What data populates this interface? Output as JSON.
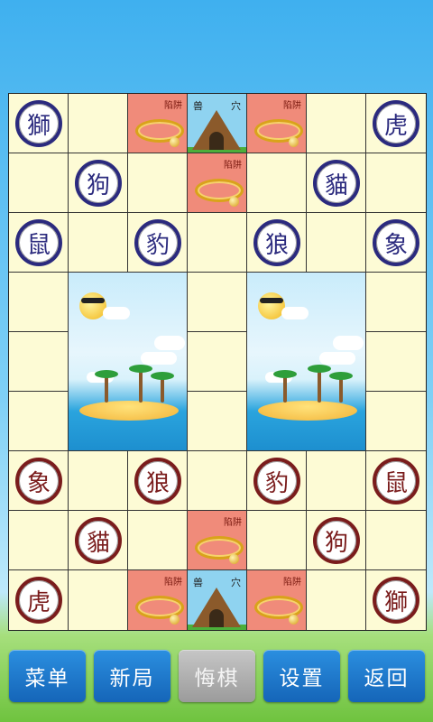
{
  "colors": {
    "blue_piece": "#2b2a7e",
    "red_piece": "#7a1c1c",
    "board": "#fdfbd5",
    "trap": "#f08b7a",
    "button": "#1e78cc",
    "button_disabled": "#a8a8a8"
  },
  "labels": {
    "trap": "陷阱",
    "den_left": "兽",
    "den_right": "穴"
  },
  "pieces": [
    {
      "row": 0,
      "col": 0,
      "side": "blue",
      "char": "獅"
    },
    {
      "row": 0,
      "col": 6,
      "side": "blue",
      "char": "虎"
    },
    {
      "row": 1,
      "col": 1,
      "side": "blue",
      "char": "狗"
    },
    {
      "row": 1,
      "col": 5,
      "side": "blue",
      "char": "貓"
    },
    {
      "row": 2,
      "col": 0,
      "side": "blue",
      "char": "鼠"
    },
    {
      "row": 2,
      "col": 2,
      "side": "blue",
      "char": "豹"
    },
    {
      "row": 2,
      "col": 4,
      "side": "blue",
      "char": "狼"
    },
    {
      "row": 2,
      "col": 6,
      "side": "blue",
      "char": "象"
    },
    {
      "row": 6,
      "col": 0,
      "side": "red",
      "char": "象"
    },
    {
      "row": 6,
      "col": 2,
      "side": "red",
      "char": "狼"
    },
    {
      "row": 6,
      "col": 4,
      "side": "red",
      "char": "豹"
    },
    {
      "row": 6,
      "col": 6,
      "side": "red",
      "char": "鼠"
    },
    {
      "row": 7,
      "col": 1,
      "side": "red",
      "char": "貓"
    },
    {
      "row": 7,
      "col": 5,
      "side": "red",
      "char": "狗"
    },
    {
      "row": 8,
      "col": 0,
      "side": "red",
      "char": "虎"
    },
    {
      "row": 8,
      "col": 6,
      "side": "red",
      "char": "獅"
    }
  ],
  "traps": [
    [
      0,
      2
    ],
    [
      0,
      4
    ],
    [
      1,
      3
    ],
    [
      7,
      3
    ],
    [
      8,
      2
    ],
    [
      8,
      4
    ]
  ],
  "dens": [
    [
      0,
      3
    ],
    [
      8,
      3
    ]
  ],
  "water_areas": [
    {
      "col": 1,
      "row": 3
    },
    {
      "col": 4,
      "row": 3
    }
  ],
  "buttons": [
    {
      "label": "菜单",
      "enabled": true
    },
    {
      "label": "新局",
      "enabled": true
    },
    {
      "label": "悔棋",
      "enabled": false
    },
    {
      "label": "设置",
      "enabled": true
    },
    {
      "label": "返回",
      "enabled": true
    }
  ]
}
